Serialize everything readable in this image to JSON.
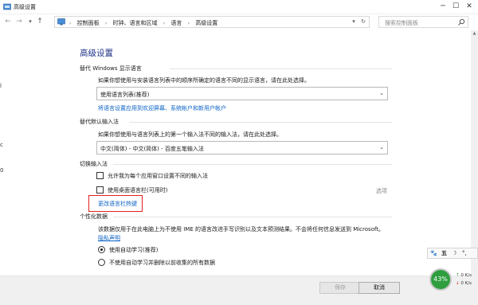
{
  "window": {
    "title": "高级设置",
    "minimize": "─",
    "maximize": "☐",
    "close": "✕"
  },
  "nav": {
    "back": "←",
    "forward": "→",
    "dropdown": "▾",
    "up": "↑"
  },
  "address": {
    "crumbs": [
      "控制面板",
      "时钟、语言和区域",
      "语言",
      "高级设置"
    ],
    "separator": "›",
    "dropdown": "▾",
    "refresh": "↻"
  },
  "search": {
    "placeholder": "搜索控制面板"
  },
  "left_truncated": [
    "l",
    "c",
    "0"
  ],
  "page_title": "高级设置",
  "sections": {
    "display_language": {
      "heading": "替代 Windows 显示语言",
      "desc": "如果你想使用与安装语言列表中的顺序所确定的语言不同的显示语言，请在此处选择。",
      "dropdown_value": "使用语言列表(推荐)",
      "link": "将语言设置应用到欢迎屏幕、系统帐户和新用户帐户"
    },
    "default_input": {
      "heading": "替代默认输入法",
      "desc": "如果你想使用与语言列表上的第一个输入法不同的输入法，请在此处选择。",
      "dropdown_value": "中文(简体) - 中文(简体) - 百度五笔输入法"
    },
    "switch_input": {
      "heading": "切换输入法",
      "checkbox1": "允许我为每个应用窗口设置不同的输入法",
      "checkbox2": "使用桌面语言栏(可用时)",
      "options": "选项",
      "hotkeys_link": "更改语言栏热键"
    },
    "personalization": {
      "heading": "个性化数据",
      "desc": "该数据仅用于在此电脑上为不使用 IME 的语言改进手写识别以及文本预测结果。不会将任何信息发送到 Microsoft。",
      "privacy_link": "隐私声明",
      "radio1": "使用自动学习(推荐)",
      "radio2": "不使用自动学习并删除以前收集的所有数据"
    }
  },
  "footer": {
    "save": "保存",
    "cancel": "取消"
  },
  "ime_bar": {
    "logo": "🐾",
    "mode": "五",
    "moon": "☽",
    "punct": "°,"
  },
  "net_meter": {
    "percent": "43%",
    "up": "0   K/s",
    "down": "0   K/s"
  },
  "colors": {
    "title_blue": "#1e3287",
    "link_blue": "#0b63c6",
    "highlight_red": "#e52020",
    "meter_green": "#2e9e3e"
  }
}
